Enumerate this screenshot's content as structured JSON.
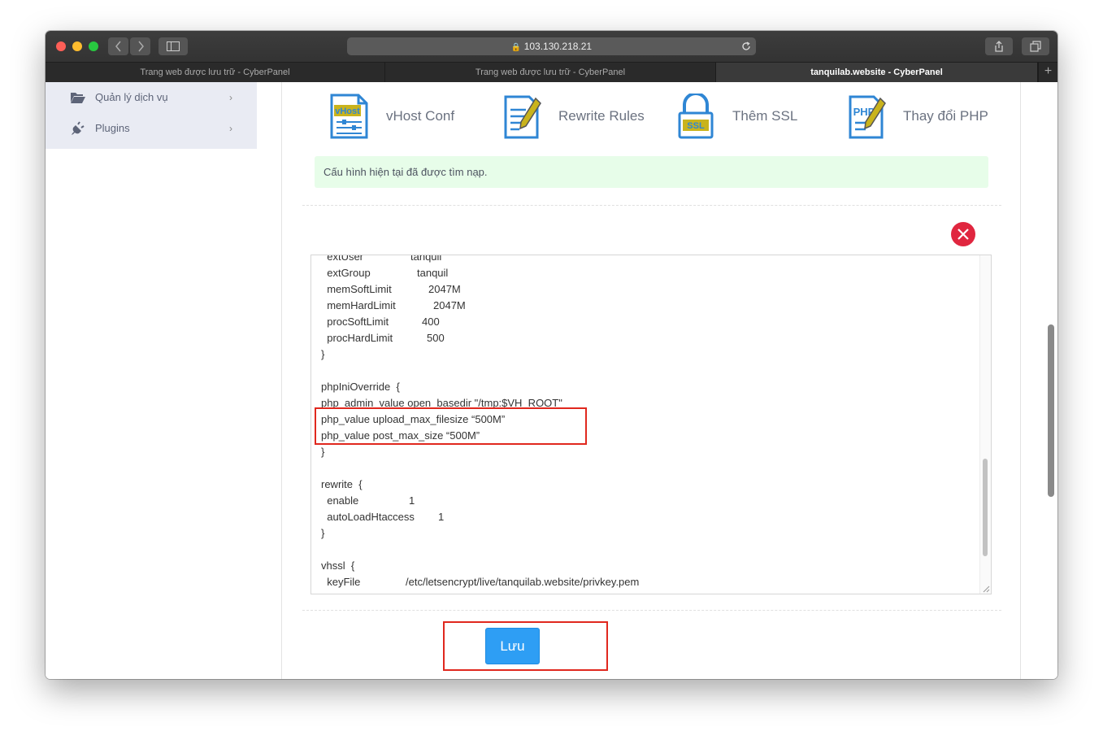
{
  "browser": {
    "url": "103.130.218.21",
    "tabs": [
      {
        "label": "Trang web được lưu trữ - CyberPanel",
        "active": false
      },
      {
        "label": "Trang web được lưu trữ - CyberPanel",
        "active": false
      },
      {
        "label": "tanquilab.website - CyberPanel",
        "active": true
      }
    ],
    "new_tab": "+"
  },
  "sidebar": {
    "items": [
      {
        "label": "Quản lý dịch vụ",
        "icon": "folder-open-icon",
        "chevron": "›"
      },
      {
        "label": "Plugins",
        "icon": "plug-icon",
        "chevron": "›"
      }
    ]
  },
  "tools": [
    {
      "label": "vHost Conf",
      "icon": "vhost-icon",
      "icon_text": "vHost"
    },
    {
      "label": "Rewrite Rules",
      "icon": "rewrite-rules-icon"
    },
    {
      "label": "Thêm SSL",
      "icon": "ssl-lock-icon",
      "icon_text": "SSL"
    },
    {
      "label": "Thay đổi PHP",
      "icon": "php-icon",
      "icon_text": "PHP"
    }
  ],
  "alert": {
    "message": "Cấu hình hiện tại đã được tìm nạp."
  },
  "editor": {
    "lines": [
      {
        "key": "  extUser",
        "value": "tanquil"
      },
      {
        "key": "  extGroup",
        "value": "tanquil"
      },
      {
        "key": "  memSoftLimit",
        "value": "2047M"
      },
      {
        "key": "  memHardLimit",
        "value": "2047M"
      },
      {
        "key": "  procSoftLimit",
        "value": "400"
      },
      {
        "key": "  procHardLimit",
        "value": "500"
      },
      {
        "key": "}",
        "value": ""
      },
      {
        "key": "",
        "value": ""
      },
      {
        "key": "phpIniOverride  {",
        "value": ""
      },
      {
        "key": "php_admin_value open_basedir \"/tmp:$VH_ROOT\"",
        "value": ""
      },
      {
        "key": "php_value upload_max_filesize “500M”",
        "value": ""
      },
      {
        "key": "php_value post_max_size “500M”",
        "value": ""
      },
      {
        "key": "}",
        "value": ""
      },
      {
        "key": "",
        "value": ""
      },
      {
        "key": "rewrite  {",
        "value": ""
      },
      {
        "key": "  enable",
        "value": "1"
      },
      {
        "key": "  autoLoadHtaccess",
        "value": "1"
      },
      {
        "key": "}",
        "value": ""
      },
      {
        "key": "",
        "value": ""
      },
      {
        "key": "vhssl  {",
        "value": ""
      },
      {
        "key": "  keyFile",
        "value": "/etc/letsencrypt/live/tanquilab.website/privkey.pem"
      }
    ]
  },
  "save_button": {
    "label": "Lưu"
  },
  "colors": {
    "alert_bg": "#e7fde9",
    "save_button": "#2e9ef4",
    "close_button": "#e0263f",
    "highlight_box": "#e0281e",
    "icon_blue": "#2f86d4",
    "icon_yellow": "#c9b31c"
  }
}
